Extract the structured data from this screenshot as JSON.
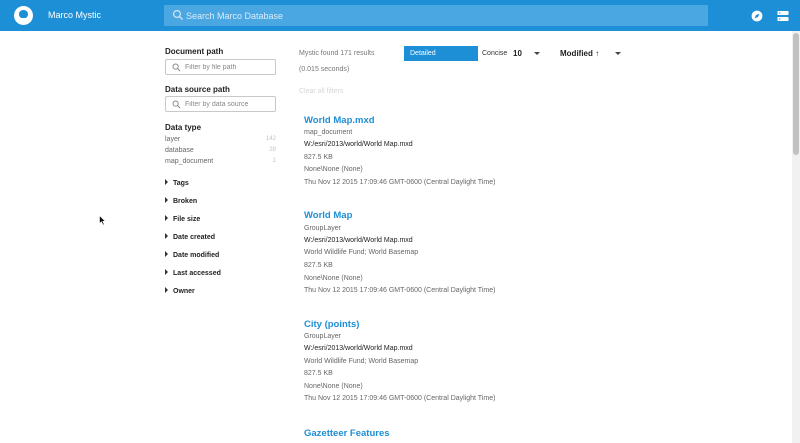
{
  "header": {
    "app_title": "Marco Mystic",
    "search_placeholder": "Search Marco Database",
    "colors": {
      "bar": "#1d8fd6",
      "search_bg": "#4aa7e2"
    },
    "icons": [
      "search-icon",
      "compass-icon",
      "server-list-icon"
    ]
  },
  "sidebar": {
    "document_path": {
      "title": "Document path",
      "placeholder": "Filter by file path"
    },
    "data_source_path": {
      "title": "Data source path",
      "placeholder": "Filter by data source"
    },
    "data_type": {
      "title": "Data type",
      "items": [
        {
          "label": "layer",
          "count": "142"
        },
        {
          "label": "database",
          "count": "28"
        },
        {
          "label": "map_document",
          "count": "1"
        }
      ]
    },
    "collapsibles": [
      "Tags",
      "Broken",
      "File size",
      "Date created",
      "Date modified",
      "Last accessed",
      "Owner"
    ]
  },
  "results_header": {
    "found_text": "Mystic found 171 results",
    "time_text": "(0.015 seconds)",
    "view_detailed": "Detailed",
    "view_concise": "Concise",
    "page_size": "10",
    "sort": "Modified ↑",
    "clear_filters": "Clear all filters"
  },
  "results": [
    {
      "title": "World Map.mxd",
      "type": "map_document",
      "path": "W:/esri/2013/world/World Map.mxd",
      "size": "827.5 KB",
      "owner": "None\\None (None)",
      "date": "Thu Nov 12 2015 17:09:46 GMT-0600 (Central Daylight Time)"
    },
    {
      "title": "World Map",
      "type": "GroupLayer",
      "path": "W:/esri/2013/world/World Map.mxd",
      "sources": "World Wildlife Fund; World Basemap",
      "size": "827.5 KB",
      "owner": "None\\None (None)",
      "date": "Thu Nov 12 2015 17:09:46 GMT-0600 (Central Daylight Time)"
    },
    {
      "title": "City (points)",
      "type": "GroupLayer",
      "path": "W:/esri/2013/world/World Map.mxd",
      "sources": "World Wildlife Fund; World Basemap",
      "size": "827.5 KB",
      "owner": "None\\None (None)",
      "date": "Thu Nov 12 2015 17:09:46 GMT-0600 (Central Daylight Time)"
    },
    {
      "title": "Gazetteer Features"
    }
  ]
}
